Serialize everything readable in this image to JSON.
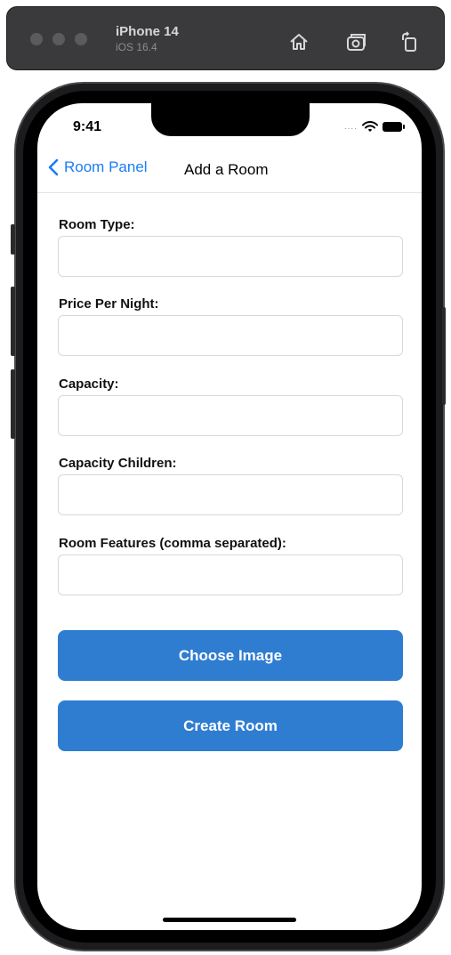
{
  "simulator": {
    "device_name": "iPhone 14",
    "os_version": "iOS 16.4",
    "icons": [
      "home-icon",
      "screenshot-icon",
      "rotate-icon"
    ]
  },
  "status_bar": {
    "time": "9:41",
    "dots": "....",
    "icons": [
      "wifi-icon",
      "battery-icon"
    ]
  },
  "nav": {
    "back_label": "Room Panel",
    "title": "Add a Room",
    "back_icon": "chevron-left-icon"
  },
  "form": {
    "fields": [
      {
        "label": "Room Type:",
        "value": ""
      },
      {
        "label": "Price Per Night:",
        "value": ""
      },
      {
        "label": "Capacity:",
        "value": ""
      },
      {
        "label": "Capacity Children:",
        "value": ""
      },
      {
        "label": "Room Features (comma separated):",
        "value": ""
      }
    ]
  },
  "buttons": {
    "choose_image": "Choose Image",
    "create_room": "Create Room"
  },
  "colors": {
    "accent": "#1a7cf5",
    "button": "#2f7dd1"
  }
}
